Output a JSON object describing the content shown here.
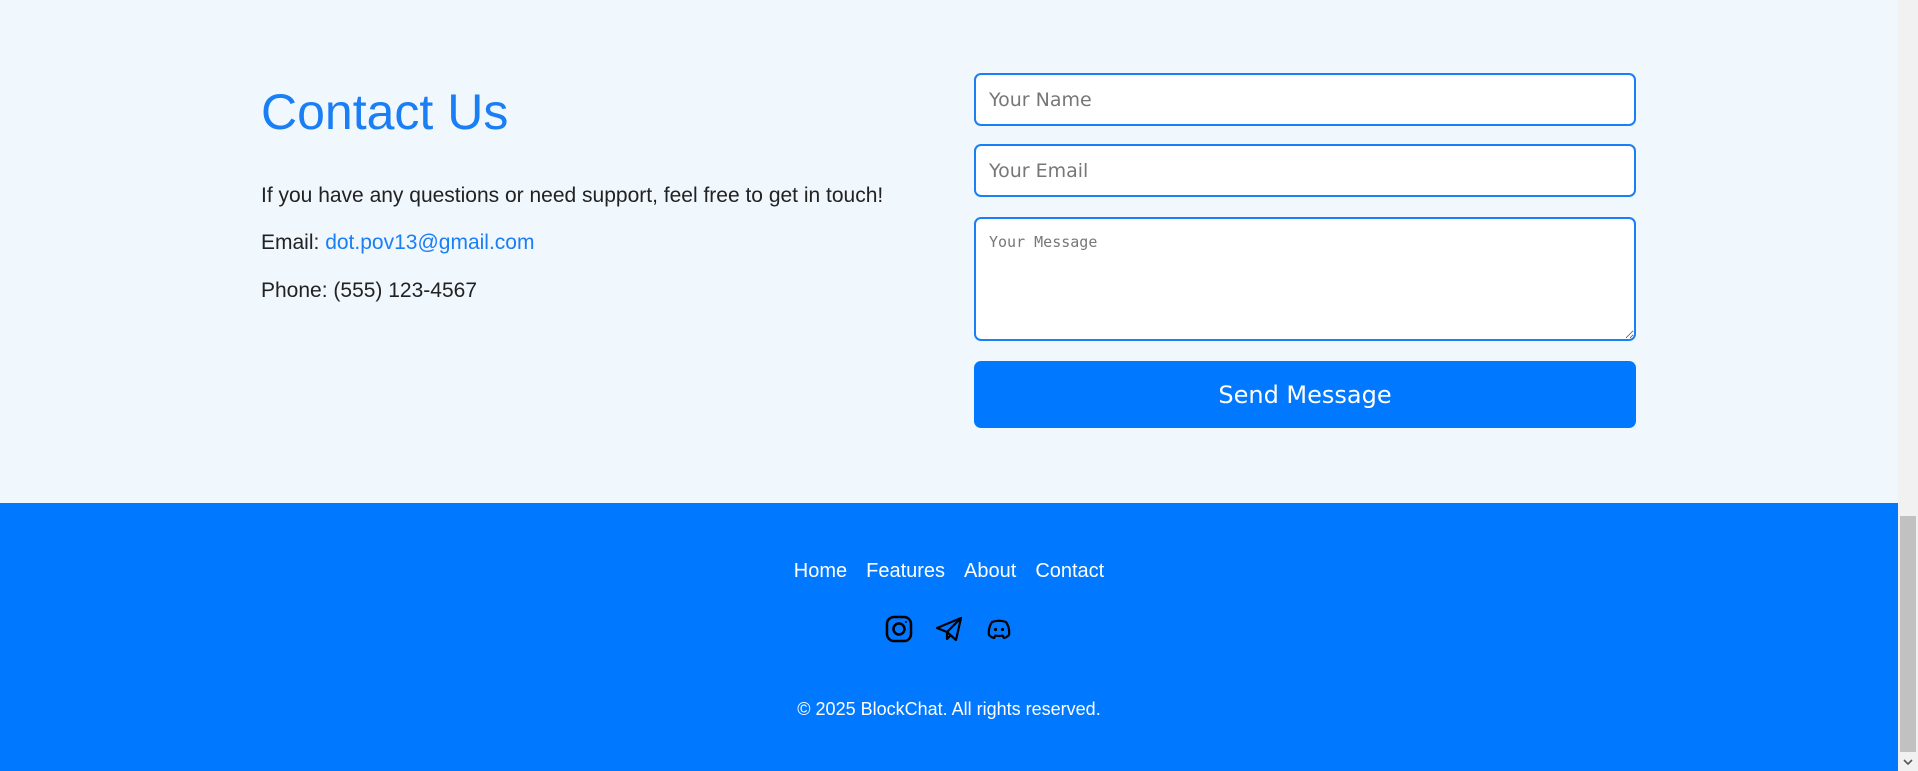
{
  "contact": {
    "title": "Contact Us",
    "intro": "If you have any questions or need support, feel free to get in touch!",
    "email_label": "Email:",
    "email_value": "dot.pov13@gmail.com",
    "phone": "Phone: (555) 123-4567"
  },
  "form": {
    "name_placeholder": "Your Name",
    "email_placeholder": "Your Email",
    "message_placeholder": "Your Message",
    "submit": "Send Message"
  },
  "footer": {
    "nav": [
      "Home",
      "Features",
      "About",
      "Contact"
    ],
    "social_icons": [
      "instagram-icon",
      "telegram-icon",
      "discord-icon"
    ],
    "copyright": "© 2025 BlockChat. All rights reserved."
  },
  "colors": {
    "accent": "#0078ff",
    "heading": "#1a7ef5",
    "background": "#f0f7fd"
  }
}
